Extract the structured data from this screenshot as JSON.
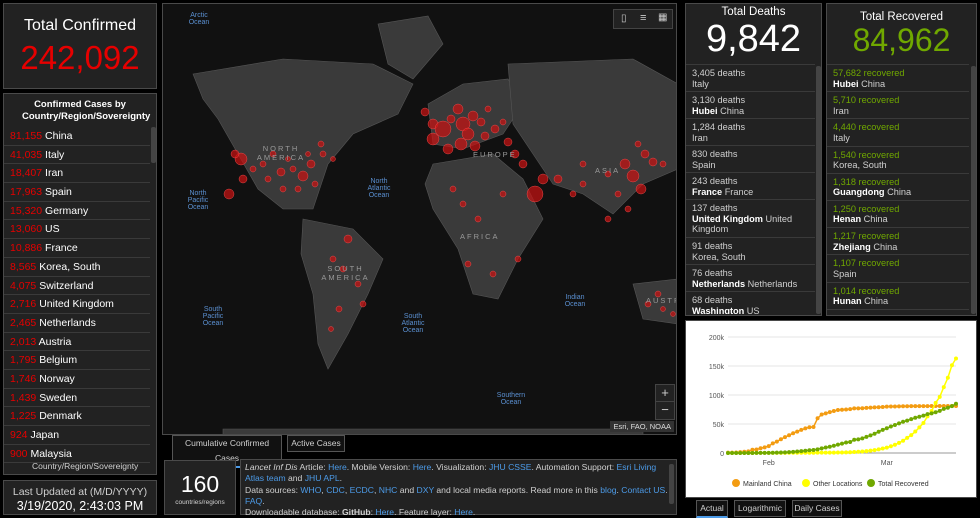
{
  "colors": {
    "red": "#e60000",
    "green": "#70a800",
    "text": "#d0d0d0",
    "panel": "#222222"
  },
  "confirmed": {
    "title": "Total Confirmed",
    "value": "242,092"
  },
  "confirmed_list": {
    "title": "Confirmed Cases by Country/Region/Sovereignty",
    "footer": "Country/Region/Sovereignty",
    "items": [
      {
        "count": "81,155",
        "name": "China"
      },
      {
        "count": "41,035",
        "name": "Italy"
      },
      {
        "count": "18,407",
        "name": "Iran"
      },
      {
        "count": "17,963",
        "name": "Spain"
      },
      {
        "count": "15,320",
        "name": "Germany"
      },
      {
        "count": "13,060",
        "name": "US"
      },
      {
        "count": "10,886",
        "name": "France"
      },
      {
        "count": "8,565",
        "name": "Korea, South"
      },
      {
        "count": "4,075",
        "name": "Switzerland"
      },
      {
        "count": "2,716",
        "name": "United Kingdom"
      },
      {
        "count": "2,465",
        "name": "Netherlands"
      },
      {
        "count": "2,013",
        "name": "Austria"
      },
      {
        "count": "1,795",
        "name": "Belgium"
      },
      {
        "count": "1,746",
        "name": "Norway"
      },
      {
        "count": "1,439",
        "name": "Sweden"
      },
      {
        "count": "1,225",
        "name": "Denmark"
      },
      {
        "count": "924",
        "name": "Japan"
      },
      {
        "count": "900",
        "name": "Malaysia"
      }
    ]
  },
  "updated": {
    "label": "Last Updated at (M/D/YYYY)",
    "value": "3/19/2020, 2:43:03 PM"
  },
  "map": {
    "labels": {
      "arctic": "Arctic Ocean",
      "north_america": "NORTH AMERICA",
      "north_atlantic": "North Atlantic Ocean",
      "north_pacific": "North Pacific Ocean",
      "europe": "EUROPE",
      "asia": "ASIA",
      "africa": "AFRICA",
      "south_america": "SOUTH AMERICA",
      "south_pacific": "South Pacific Ocean",
      "south_atlantic": "South Atlantic Ocean",
      "indian": "Indian Ocean",
      "southern": "Southern Ocean",
      "austr": "AUSTR"
    },
    "attribution": "Esri, FAO, NOAA",
    "zoom_in": "+",
    "zoom_out": "−"
  },
  "map_tabs": [
    {
      "label": "Cumulative Confirmed Cases",
      "active": true
    },
    {
      "label": "Active Cases",
      "active": false
    }
  ],
  "regions": {
    "count": "160",
    "label": "countries/regions"
  },
  "info": {
    "line1_italic": "Lancet Inf Dis",
    "line1_a": " Article: ",
    "here": "Here",
    "line1_b": ". Mobile Version: ",
    "line1_c": ". Visualization: ",
    "jhu": "JHU CSSE",
    "line1_d": ". Automation Support: ",
    "esri": "Esri Living Atlas team",
    "and": " and ",
    "jhuapl": "JHU APL",
    "ds": "Data sources: ",
    "who": "WHO",
    "cdc": "CDC",
    "ecdc": "ECDC",
    "nhc": "NHC",
    "dxy": "DXY",
    "ds_tail": " and local media reports. Read more in this ",
    "blog": "blog",
    "contact": "Contact US",
    "faq": "FAQ",
    "dl": "Downloadable database: ",
    "github": "GitHub",
    "feature": "Feature layer: "
  },
  "deaths": {
    "title": "Total Deaths",
    "value": "9,842",
    "items": [
      {
        "count": "3,405 deaths",
        "bold": "",
        "rest": "Italy"
      },
      {
        "count": "3,130 deaths",
        "bold": "Hubei",
        "rest": " China"
      },
      {
        "count": "1,284 deaths",
        "bold": "",
        "rest": "Iran"
      },
      {
        "count": "830 deaths",
        "bold": "",
        "rest": "Spain"
      },
      {
        "count": "243 deaths",
        "bold": "France",
        "rest": " France"
      },
      {
        "count": "137 deaths",
        "bold": "United Kingdom",
        "rest": " United Kingdom"
      },
      {
        "count": "91 deaths",
        "bold": "",
        "rest": "Korea, South"
      },
      {
        "count": "76 deaths",
        "bold": "Netherlands",
        "rest": " Netherlands"
      },
      {
        "count": "68 deaths",
        "bold": "Washington",
        "rest": " US"
      }
    ]
  },
  "recovered": {
    "title": "Total Recovered",
    "value": "84,962",
    "items": [
      {
        "count": "57,682 recovered",
        "bold": "Hubei",
        "rest": " China"
      },
      {
        "count": "5,710 recovered",
        "bold": "",
        "rest": "Iran"
      },
      {
        "count": "4,440 recovered",
        "bold": "",
        "rest": "Italy"
      },
      {
        "count": "1,540 recovered",
        "bold": "",
        "rest": "Korea, South"
      },
      {
        "count": "1,318 recovered",
        "bold": "Guangdong",
        "rest": " China"
      },
      {
        "count": "1,250 recovered",
        "bold": "Henan",
        "rest": " China"
      },
      {
        "count": "1,217 recovered",
        "bold": "Zhejiang",
        "rest": " China"
      },
      {
        "count": "1,107 recovered",
        "bold": "",
        "rest": "Spain"
      },
      {
        "count": "1,014 recovered",
        "bold": "Hunan",
        "rest": " China"
      }
    ]
  },
  "chart_tabs": [
    {
      "label": "Actual",
      "active": true
    },
    {
      "label": "Logarithmic",
      "active": false
    },
    {
      "label": "Daily Cases",
      "active": false
    }
  ],
  "chart_data": {
    "type": "line",
    "ylim": [
      0,
      200000
    ],
    "yticks": [
      "0",
      "50k",
      "100k",
      "150k",
      "200k"
    ],
    "xticks": [
      "Feb",
      "Mar"
    ],
    "x_start": "2020-01-22",
    "x_end": "2020-03-18",
    "series": [
      {
        "name": "Mainland China",
        "color": "#f39c12",
        "values": [
          548,
          643,
          920,
          1406,
          2075,
          2877,
          5509,
          6087,
          8141,
          9802,
          11891,
          16630,
          19716,
          23707,
          27440,
          30587,
          34110,
          36814,
          39829,
          42354,
          44386,
          44759,
          59895,
          66358,
          68413,
          70513,
          72434,
          74211,
          74619,
          75077,
          75550,
          77001,
          77022,
          77241,
          77754,
          78166,
          78600,
          78928,
          79356,
          79932,
          80136,
          80261,
          80386,
          80537,
          80690,
          80770,
          80823,
          80860,
          80887,
          80921,
          80932,
          80945,
          80977,
          81003,
          81033,
          81058,
          81102
        ]
      },
      {
        "name": "Other Locations",
        "color": "#ffff00",
        "values": [
          7,
          11,
          21,
          28,
          43,
          60,
          70,
          98,
          123,
          153,
          208,
          230,
          265,
          295,
          309,
          353,
          367,
          404,
          451,
          475,
          521,
          532,
          554,
          578,
          628,
          646,
          744,
          835,
          928,
          1151,
          1375,
          1789,
          2198,
          2648,
          3246,
          4015,
          5004,
          6242,
          7757,
          9327,
          11560,
          14223,
          17487,
          21211,
          26004,
          30888,
          36968,
          44279,
          51725,
          63041,
          72478,
          86409,
          96706,
          113612,
          129838,
          151270,
          163008
        ]
      },
      {
        "name": "Total Recovered",
        "color": "#70a800",
        "values": [
          28,
          30,
          36,
          39,
          52,
          61,
          107,
          126,
          143,
          222,
          284,
          472,
          623,
          852,
          1124,
          1487,
          2011,
          2616,
          3244,
          3946,
          4683,
          5150,
          6295,
          8058,
          9395,
          10865,
          12583,
          14352,
          16121,
          18177,
          18890,
          22886,
          23394,
          25227,
          27905,
          30384,
          33277,
          36711,
          39782,
          42716,
          45602,
          48228,
          51171,
          53797,
          55866,
          58359,
          60695,
          62512,
          64404,
          67003,
          68324,
          70251,
          72624,
          76034,
          78088,
          80840,
          84962
        ]
      }
    ],
    "legend": [
      "Mainland China",
      "Other Locations",
      "Total Recovered"
    ]
  }
}
